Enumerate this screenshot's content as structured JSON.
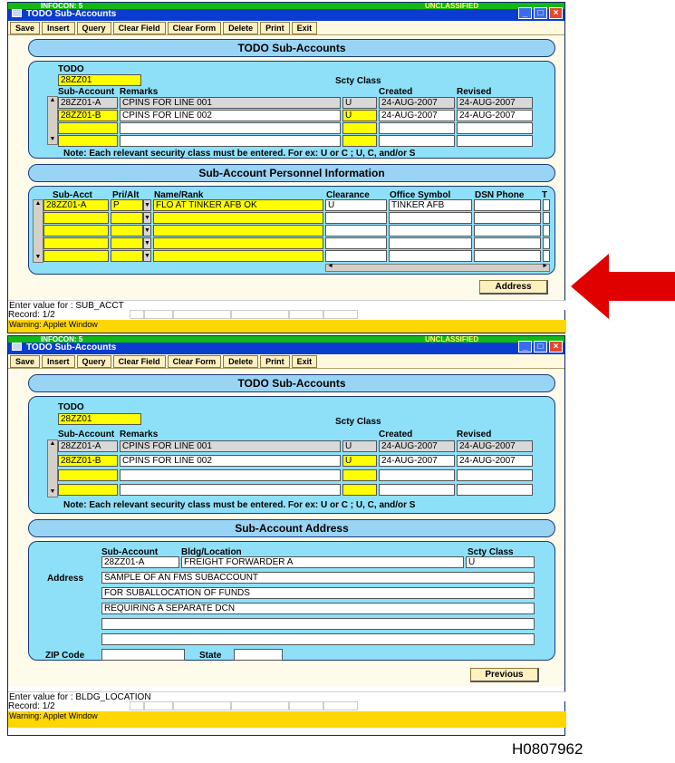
{
  "windows": [
    {
      "infocon": "INFOCON: 5",
      "classification": "UNCLASSIFIED",
      "title": "TODO Sub-Accounts",
      "toolbar": [
        "Save",
        "Insert",
        "Query",
        "Clear Field",
        "Clear Form",
        "Delete",
        "Print",
        "Exit"
      ],
      "header": "TODO Sub-Accounts",
      "todo_label": "TODO",
      "todo_value": "28ZZ01",
      "scty_class_label": "Scty Class",
      "cols": {
        "sub_account": "Sub-Account",
        "remarks": "Remarks",
        "created": "Created",
        "revised": "Revised"
      },
      "rows": [
        {
          "sub": "28ZZ01-A",
          "remarks": "CPINS FOR LINE 001",
          "scty": "U",
          "created": "24-AUG-2007",
          "revised": "24-AUG-2007"
        },
        {
          "sub": "28ZZ01-B",
          "remarks": "CPINS FOR LINE 002",
          "scty": "U",
          "created": "24-AUG-2007",
          "revised": "24-AUG-2007"
        }
      ],
      "note": "Note: Each relevant security class must be entered. For ex: U or C ; U, C, and/or S",
      "section2": "Sub-Account Personnel Information",
      "personnel_cols": {
        "sub_acct": "Sub-Acct",
        "pri_alt": "Pri/Alt",
        "name_rank": "Name/Rank",
        "clearance": "Clearance",
        "office_symbol": "Office Symbol",
        "dsn_phone": "DSN Phone",
        "t": "T"
      },
      "personnel_row": {
        "sub_acct": "28ZZ01-A",
        "pri_alt": "P",
        "name_rank": "FLO AT TINKER AFB OK",
        "clearance": "U",
        "office_symbol": "TINKER AFB"
      },
      "button": "Address",
      "status": "Enter value for : SUB_ACCT",
      "record": "Record: 1/2",
      "warning": "Warning: Applet Window"
    },
    {
      "infocon": "INFOCON: 5",
      "classification": "UNCLASSIFIED",
      "title": "TODO Sub-Accounts",
      "toolbar": [
        "Save",
        "Insert",
        "Query",
        "Clear Field",
        "Clear Form",
        "Delete",
        "Print",
        "Exit"
      ],
      "header": "TODO Sub-Accounts",
      "todo_label": "TODO",
      "todo_value": "28ZZ01",
      "scty_class_label": "Scty Class",
      "cols": {
        "sub_account": "Sub-Account",
        "remarks": "Remarks",
        "created": "Created",
        "revised": "Revised"
      },
      "rows": [
        {
          "sub": "28ZZ01-A",
          "remarks": "CPINS FOR LINE 001",
          "scty": "U",
          "created": "24-AUG-2007",
          "revised": "24-AUG-2007"
        },
        {
          "sub": "28ZZ01-B",
          "remarks": "CPINS FOR LINE 002",
          "scty": "U",
          "created": "24-AUG-2007",
          "revised": "24-AUG-2007"
        }
      ],
      "note": "Note: Each relevant security class must be entered. For ex: U or C ; U, C, and/or S",
      "section2": "Sub-Account Address",
      "address": {
        "sub_account_label": "Sub-Account",
        "bldg_label": "Bldg/Location",
        "scty_label": "Scty Class",
        "sub_account": "28ZZ01-A",
        "bldg": "FREIGHT FORWARDER A",
        "scty": "U",
        "address_label": "Address",
        "lines": [
          "SAMPLE OF AN FMS SUBACCOUNT",
          "FOR SUBALLOCATION OF FUNDS",
          "REQUIRING A SEPARATE DCN"
        ],
        "zip_label": "ZIP Code",
        "state_label": "State"
      },
      "button": "Previous",
      "status": "Enter value for : BLDG_LOCATION",
      "record": "Record: 1/2",
      "warning": "Warning: Applet Window"
    }
  ],
  "doc_id": "H0807962",
  "colors": {
    "arrow": "#e00000",
    "yellow_field": "#ffff00",
    "panel": "#8ee0f8"
  }
}
